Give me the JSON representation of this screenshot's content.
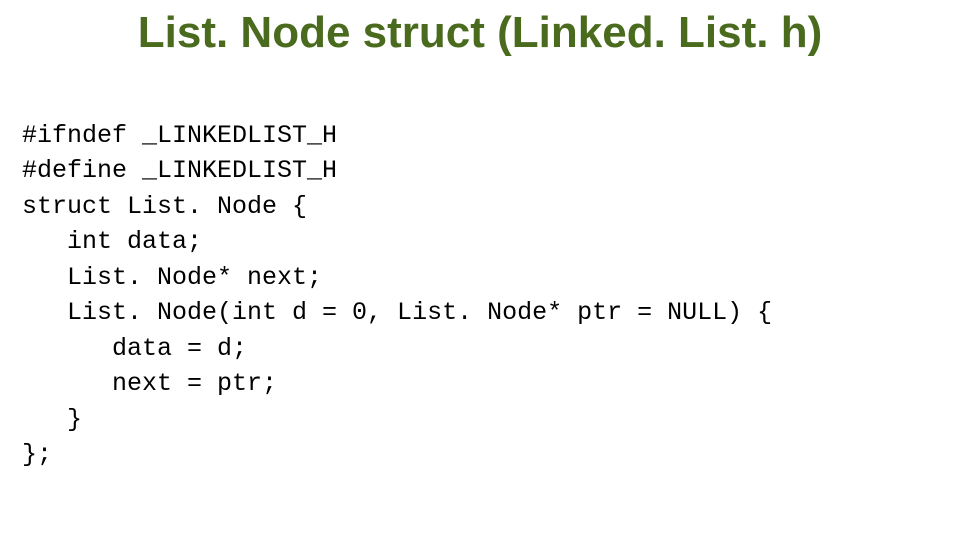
{
  "title": "List. Node struct (Linked. List. h)",
  "code": {
    "l1": "#ifndef _LINKEDLIST_H",
    "l2": "#define _LINKEDLIST_H",
    "l3": "struct List. Node {",
    "l4": "   int data;",
    "l5": "   List. Node* next;",
    "l6": "   List. Node(int d = 0, List. Node* ptr = NULL) {",
    "l7": "      data = d;",
    "l8": "      next = ptr;",
    "l9": "   }",
    "l10": "};"
  }
}
